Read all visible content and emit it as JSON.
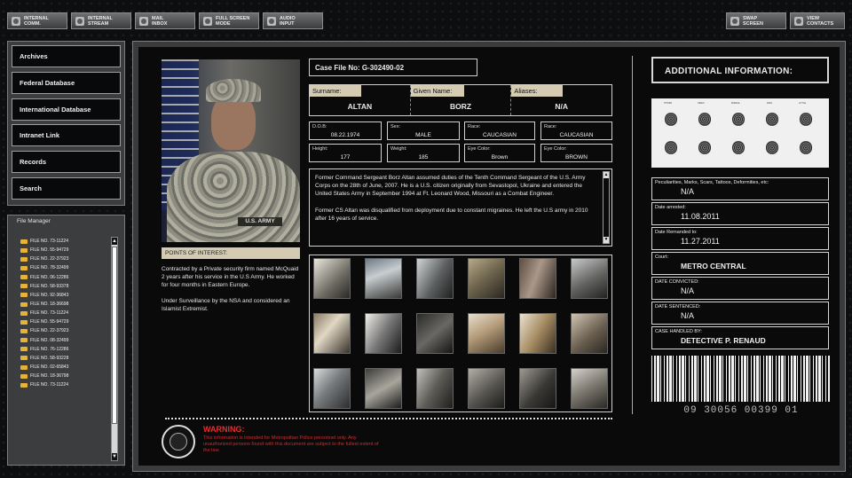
{
  "toolbar": {
    "internal_comm": [
      "INTERNAL",
      "COMM."
    ],
    "internal_stream": [
      "INTERNAL",
      "STREAM"
    ],
    "mail_inbox": [
      "MAIL",
      "INBOX"
    ],
    "full_screen": [
      "FULL SCREEN",
      "MODE"
    ],
    "audio_input": [
      "AUDIO",
      "INPUT"
    ],
    "swap_screen": [
      "SWAP",
      "SCREEN"
    ],
    "view_contacts": [
      "VIEW",
      "CONTACTS"
    ]
  },
  "nav": {
    "items": [
      "Archives",
      "Federal Database",
      "International Database",
      "Intranet Link",
      "Records",
      "Search"
    ]
  },
  "file_manager": {
    "title": "File Manager",
    "files": [
      "FILE NO. 73-11224",
      "FILE NO. 55-94729",
      "FILE NO. 22-37923",
      "FILE NO. 78-32499",
      "FILE NO. 06-12286",
      "FILE NO. 58-93378",
      "FILE NO. 92-36843",
      "FILE NO. 18-36698",
      "FILE NO. 73-11224",
      "FILE NO. 55-94729",
      "FILE NO. 22-37923",
      "FILE NO. 08-32499",
      "FILE NO. 76-12286",
      "FILE NO. 58-93228",
      "FILE NO. 02-65843",
      "FILE NO. 18-36798",
      "FILE NO. 73-11224"
    ]
  },
  "profile": {
    "photo_tag": "U.S. ARMY",
    "case_file": "Case File No: G-302490-02",
    "surname_label": "Surname:",
    "surname": "ALTAN",
    "given_label": "Given Name:",
    "given": "BORZ",
    "aliases_label": "Aliases:",
    "aliases": "N/A",
    "dob_label": "D.O.B:",
    "dob": "08.22.1974",
    "sex_label": "Sex:",
    "sex": "MALE",
    "race1_label": "Race:",
    "race1": "CAUCASIAN",
    "race2_label": "Race:",
    "race2": "CAUCASIAN",
    "height_label": "Height:",
    "height": "177",
    "weight_label": "Weight:",
    "weight": "185",
    "eye1_label": "Eye Color:",
    "eye1": "Brown",
    "eye2_label": "Eye Color:",
    "eye2": "BROWN",
    "bio_p1": "Former Command Sergeant Borz Altan assumed duties of the Tenth Command Sergeant of the U.S. Army Corps on the 28th of June, 2007.  He is a U.S. citizen originally from Sevastopol, Ukraine and entered the United States Army in September 1994 at Ft. Leonard Wood, Missouri as a Combat Engineer.",
    "bio_p2": "Former CS Altan was disqualified from deployment due to constant migraines.  He left the U.S army in 2010 after 16 years of service.",
    "poi_label": "POINTS OF INTEREST:",
    "poi_p1": "Contracted by a Private security firm named McQuaid 2 years after his service in the U.S Army.  He worked for four months in Eastern Europe.",
    "poi_p2": "Under Surveillance by the NSA and considered an Islamist Extremist."
  },
  "warning": {
    "title": "WARNING:",
    "text": "This information is intended for Metropolitan Police personnel only. Any unauthorized persons found with this document are subject to the fullest extent of the law."
  },
  "additional": {
    "title": "ADDITIONAL INFORMATION:",
    "fingerprint_headers": [
      "THUMB",
      "INDEX",
      "MIDDLE",
      "RING",
      "LITTLE"
    ],
    "peculiarities_label": "Peculiarities, Marks, Scars, Tattoos, Deformities, etc:",
    "peculiarities": "N/A",
    "arrested_label": "Date arrested:",
    "arrested": "11.08.2011",
    "remanded_label": "Date Remanded to:",
    "remanded": "11.27.2011",
    "court_label": "Court:",
    "court": "METRO CENTRAL",
    "convicted_label": "DATE CONVICTED:",
    "convicted": "N/A",
    "sentenced_label": "DATE SENTENCED:",
    "sentenced": "N/A",
    "handled_label": "CASE HANDLED BY:",
    "handled": "DETECTIVE P. RENAUD",
    "barcode_number": "09  30056  00399  01"
  },
  "colors": {
    "label_tan": "#d5cbb2",
    "warning_red": "#e03030",
    "folder_yellow": "#e6b23a"
  }
}
